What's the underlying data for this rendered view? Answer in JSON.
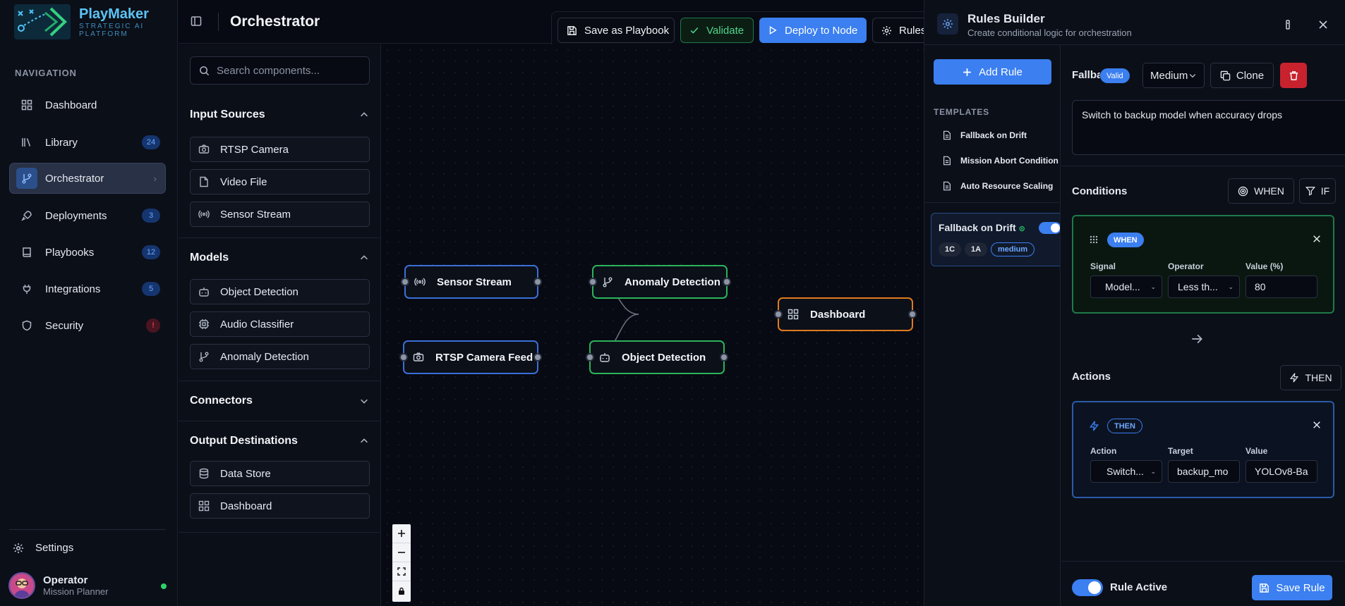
{
  "brand": {
    "title": "PlayMaker",
    "subtitle": "STRATEGIC AI PLATFORM"
  },
  "nav": {
    "heading": "NAVIGATION",
    "items": [
      {
        "label": "Dashboard",
        "icon": "grid-icon",
        "badge": ""
      },
      {
        "label": "Library",
        "icon": "library-icon",
        "badge": "24"
      },
      {
        "label": "Orchestrator",
        "icon": "git-branch-icon",
        "badge": "",
        "active": true
      },
      {
        "label": "Deployments",
        "icon": "rocket-icon",
        "badge": "3"
      },
      {
        "label": "Playbooks",
        "icon": "book-icon",
        "badge": "12"
      },
      {
        "label": "Integrations",
        "icon": "plug-icon",
        "badge": "5"
      },
      {
        "label": "Security",
        "icon": "shield-icon",
        "badge": "!"
      }
    ],
    "settings": "Settings",
    "user": {
      "name": "Operator",
      "role": "Mission Planner",
      "status_color": "#2bd46a"
    }
  },
  "header": {
    "title": "Orchestrator",
    "save_playbook": "Save as Playbook",
    "validate": "Validate",
    "deploy": "Deploy to Node",
    "rules": "Rules"
  },
  "components": {
    "search_placeholder": "Search components...",
    "sections": [
      {
        "title": "Input Sources",
        "expanded": true,
        "items": [
          "RTSP Camera",
          "Video File",
          "Sensor Stream"
        ]
      },
      {
        "title": "Models",
        "expanded": true,
        "items": [
          "Object Detection",
          "Audio Classifier",
          "Anomaly Detection"
        ]
      },
      {
        "title": "Connectors",
        "expanded": false,
        "items": []
      },
      {
        "title": "Output Destinations",
        "expanded": true,
        "items": [
          "Data Store",
          "Dashboard"
        ]
      }
    ]
  },
  "canvas": {
    "nodes": [
      {
        "label": "Sensor Stream",
        "icon": "radio-icon",
        "color": "#3b6fd8"
      },
      {
        "label": "Anomaly Detection",
        "icon": "git-branch-icon",
        "color": "#2bb35a"
      },
      {
        "label": "RTSP Camera Feed",
        "icon": "camera-icon",
        "color": "#3b6fd8"
      },
      {
        "label": "Object Detection",
        "icon": "bot-icon",
        "color": "#2bb35a"
      },
      {
        "label": "Dashboard",
        "icon": "grid-icon",
        "color": "#e07a1f"
      }
    ]
  },
  "rules_builder": {
    "title": "Rules Builder",
    "subtitle": "Create conditional logic for orchestration",
    "add_rule": "Add Rule",
    "templates_heading": "TEMPLATES",
    "templates": [
      "Fallback on Drift",
      "Mission Abort Condition",
      "Auto Resource Scaling"
    ],
    "rule_card": {
      "name": "Fallback on Drift",
      "chips": [
        "1C",
        "1A",
        "medium"
      ]
    },
    "editor": {
      "name_short": "Fallback on Drift",
      "valid_badge": "Valid",
      "priority": "Medium",
      "clone": "Clone",
      "description": "Switch to backup model when accuracy drops",
      "conditions_title": "Conditions",
      "when_btn": "WHEN",
      "if_btn": "IF",
      "condition": {
        "tag": "WHEN",
        "signal_label": "Signal",
        "signal_value": "Model...",
        "operator_label": "Operator",
        "operator_value": "Less th...",
        "value_label": "Value (%)",
        "value_value": "80"
      },
      "actions_title": "Actions",
      "then_btn": "THEN",
      "action": {
        "tag": "THEN",
        "action_label": "Action",
        "action_value": "Switch...",
        "target_label": "Target",
        "target_value": "backup_mo",
        "value_label": "Value",
        "value_value": "YOLOv8-Ba"
      },
      "rule_active": "Rule Active",
      "save_rule": "Save Rule"
    }
  }
}
